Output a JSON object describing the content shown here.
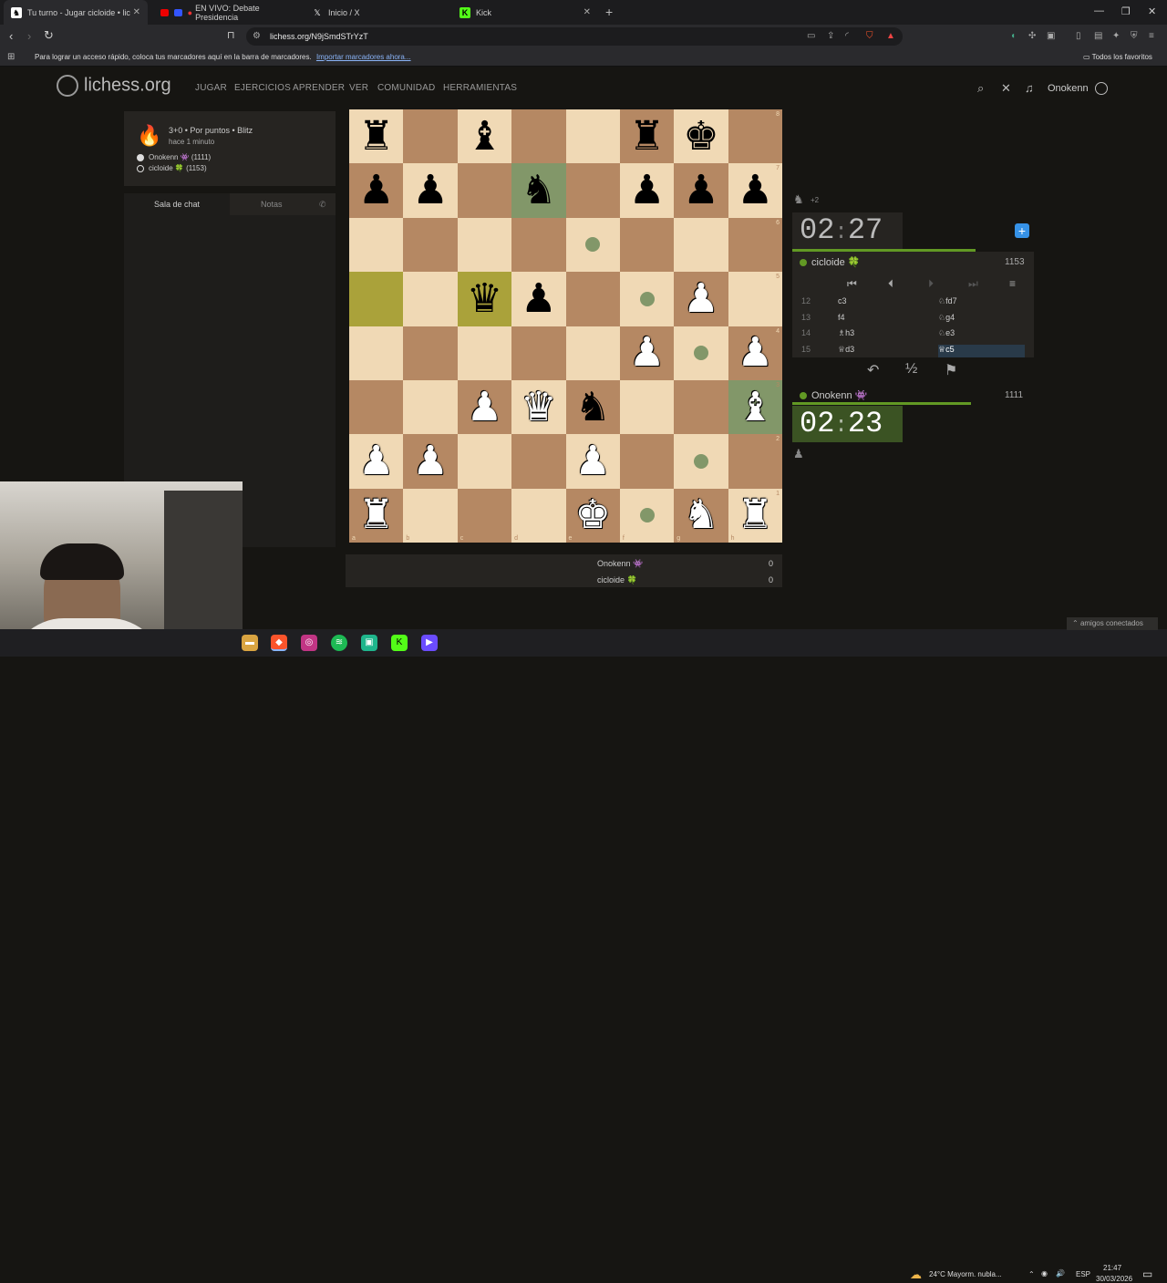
{
  "browser": {
    "tabs": [
      {
        "title": "Tu turno - Jugar cicloide • lic",
        "active": true
      },
      {
        "title": "EN VIVO: Debate Presidencia"
      },
      {
        "title": "Inicio / X"
      },
      {
        "title": "Kick"
      }
    ],
    "url": "lichess.org/N9jSmdSTrYzT",
    "bookmarks_message": "Para lograr un acceso rápido, coloca tus marcadores aquí en la barra de marcadores.",
    "bookmarks_link": "Importar marcadores ahora...",
    "all_favorites": "Todos los favoritos"
  },
  "site": {
    "logo": "lichess.org",
    "menu": [
      "JUGAR",
      "EJERCICIOS",
      "APRENDER",
      "VER",
      "COMUNIDAD",
      "HERRAMIENTAS"
    ],
    "username": "Onokenn"
  },
  "game": {
    "mode": "3+0 • Por puntos • Blitz",
    "started": "hace 1 minuto",
    "white": "Onokenn 👾 (1111)",
    "black": "cicloide 🍀 (1153)"
  },
  "chat": {
    "tab_chat": "Sala de chat",
    "tab_notes": "Notas"
  },
  "clocks": {
    "top": {
      "min": "02",
      "sec": "27"
    },
    "bottom": {
      "min": "02",
      "sec": "23"
    },
    "top_time_fraction": 0.76,
    "bottom_time_fraction": 0.74,
    "material_diff": "+2"
  },
  "players": {
    "top": {
      "name": "cicloide 🍀",
      "rating": "1153"
    },
    "bottom": {
      "name": "Onokenn 👾",
      "rating": "1111"
    }
  },
  "moves": [
    {
      "n": "12",
      "w": "c3",
      "b": "♘fd7"
    },
    {
      "n": "13",
      "w": "f4",
      "b": "♘g4"
    },
    {
      "n": "14",
      "w": "♗h3",
      "b": "♘e3"
    },
    {
      "n": "15",
      "w": "♕d3",
      "b": "♕c5"
    }
  ],
  "board": {
    "files": [
      "a",
      "b",
      "c",
      "d",
      "e",
      "f",
      "g",
      "h"
    ],
    "ranks": [
      "8",
      "7",
      "6",
      "5",
      "4",
      "3",
      "2",
      "1"
    ],
    "rows": [
      [
        "r",
        "",
        "b",
        "",
        "",
        "r",
        "k",
        ""
      ],
      [
        "p",
        "p",
        "",
        "n",
        "",
        "p",
        "p",
        "p"
      ],
      [
        "",
        "",
        "",
        "",
        "",
        "",
        "",
        ""
      ],
      [
        "",
        "",
        "q",
        "p",
        "",
        "",
        "P",
        ""
      ],
      [
        "",
        "",
        "",
        "",
        "",
        "P",
        "",
        "P"
      ],
      [
        "",
        "",
        "P",
        "Q",
        "n",
        "",
        "",
        "B"
      ],
      [
        "P",
        "P",
        "",
        "",
        "P",
        "",
        "",
        ""
      ],
      [
        "R",
        "",
        "",
        "",
        "K",
        "",
        "N",
        "R"
      ]
    ],
    "move_dots": [
      "e6",
      "f5",
      "g4",
      "g2",
      "f1"
    ],
    "last_move": [
      "a5",
      "c5"
    ],
    "selected": "h3",
    "selected_source": "d7"
  },
  "score": {
    "p1": "Onokenn 👾",
    "p1_score": "0",
    "p2": "cicloide 🍀",
    "p2_score": "0"
  },
  "taskbar": {
    "weather": "24°C  Mayorm. nubla...",
    "lang": "ESP",
    "time": "21:47",
    "date": "30/03/2026",
    "friends": "amigos conectados"
  }
}
